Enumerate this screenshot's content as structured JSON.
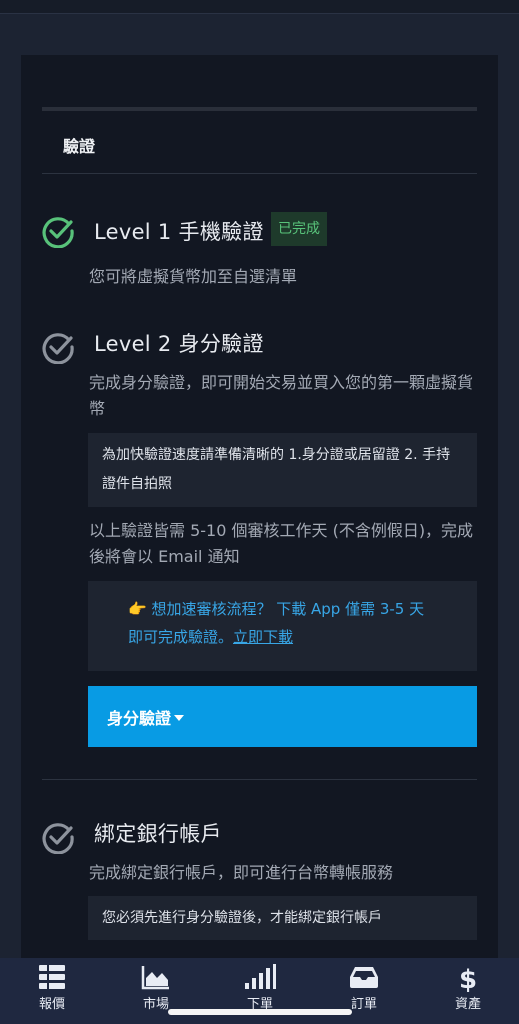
{
  "colors": {
    "background": "#1c2332",
    "card": "#121722",
    "accent_green": "#58c27a",
    "accent_blue": "#089be4",
    "link": "#38a6e6",
    "tabbar": "#1f2840"
  },
  "section": {
    "title": "驗證"
  },
  "level1": {
    "title": "Level 1 手機驗證",
    "badge": "已完成",
    "description": "您可將虛擬貨幣加至自選清單",
    "icon": "check-circle-green-icon"
  },
  "level2": {
    "title": "Level 2 身分驗證",
    "description": "完成身分驗證，即可開始交易並買入您的第一顆虛擬貨幣",
    "note": "為加快驗證速度請準備清晰的 1.身分證或居留證 2. 手持證件自拍照",
    "review_text": "以上驗證皆需 5-10 個審核工作天 (不含例假日)，完成後將會以 Email 通知",
    "promo_emoji": "👉",
    "promo_text": "想加速審核流程？ 下載 App 僅需 3-5 天即可完成驗證。",
    "promo_link": "立即下載",
    "button_label": "身分驗證",
    "icon": "check-circle-gray-icon"
  },
  "bank": {
    "title": "綁定銀行帳戶",
    "description": "完成綁定銀行帳戶，即可進行台幣轉帳服務",
    "note": "您必須先進行身分驗證後，才能綁定銀行帳戶",
    "icon": "check-circle-gray-icon"
  },
  "tabbar": {
    "items": [
      {
        "label": "報價",
        "icon": "list-icon"
      },
      {
        "label": "市場",
        "icon": "chart-area-icon"
      },
      {
        "label": "下單",
        "icon": "signal-bars-icon"
      },
      {
        "label": "訂單",
        "icon": "inbox-tray-icon"
      },
      {
        "label": "資產",
        "icon": "dollar-icon"
      }
    ]
  }
}
